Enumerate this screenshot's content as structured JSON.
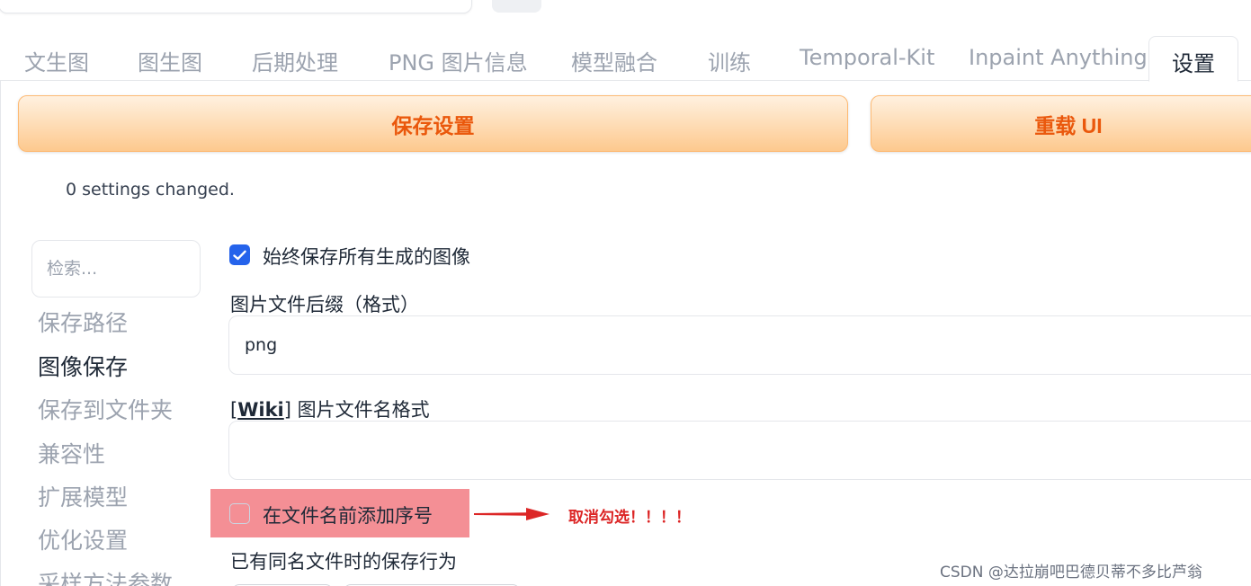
{
  "tabs": [
    {
      "label": "文生图"
    },
    {
      "label": "图生图"
    },
    {
      "label": "后期处理"
    },
    {
      "label": "PNG 图片信息"
    },
    {
      "label": "模型融合"
    },
    {
      "label": "训练"
    },
    {
      "label": "Temporal-Kit"
    },
    {
      "label": "Inpaint Anything"
    },
    {
      "label": "设置"
    }
  ],
  "actions": {
    "save_label": "保存设置",
    "reload_label": "重载 UI"
  },
  "status": {
    "changed_text": "0 settings changed."
  },
  "sidebar": {
    "search_placeholder": "检索...",
    "items": [
      {
        "label": "保存路径"
      },
      {
        "label": "图像保存"
      },
      {
        "label": "保存到文件夹"
      },
      {
        "label": "兼容性"
      },
      {
        "label": "扩展模型"
      },
      {
        "label": "优化设置"
      },
      {
        "label": "采样方法参数"
      }
    ],
    "active_index": 1
  },
  "settings": {
    "save_all_label": "始终保存所有生成的图像",
    "save_all_checked": true,
    "suffix_label": "图片文件后缀（格式）",
    "suffix_value": "png",
    "wiki_open": "[",
    "wiki_link": "Wiki",
    "wiki_close": "]",
    "filename_pattern_label": "图片文件名格式",
    "filename_pattern_value": "",
    "add_number_label": "在文件名前添加序号",
    "add_number_checked": false,
    "same_name_label": "已有同名文件时的保存行为"
  },
  "annotation": {
    "note": "取消勾选！！！！",
    "highlight_color": "#f48f95",
    "arrow_color": "#dc2626"
  },
  "watermark": "CSDN @达拉崩吧巴德贝蒂不多比芦翁",
  "colors": {
    "accent_orange": "#ea580c",
    "checkbox_blue": "#2563eb"
  }
}
